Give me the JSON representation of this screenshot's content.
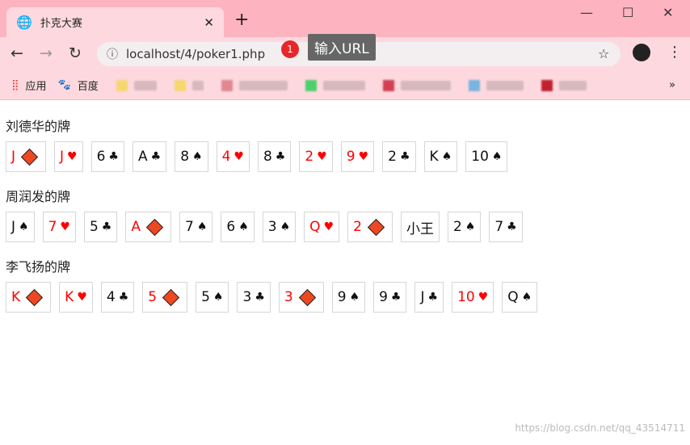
{
  "browser": {
    "tab_title": "扑克大赛",
    "url": "localhost/4/poker1.php",
    "badge": "1",
    "tooltip": "输入URL",
    "bookmarks": [
      {
        "label": "应用"
      },
      {
        "label": "百度"
      }
    ]
  },
  "players": [
    {
      "name": "刘德华的牌",
      "cards": [
        [
          "J",
          "diamond"
        ],
        [
          "J",
          "heart"
        ],
        [
          "6",
          "club"
        ],
        [
          "A",
          "club"
        ],
        [
          "8",
          "spade"
        ],
        [
          "4",
          "heart"
        ],
        [
          "8",
          "club"
        ],
        [
          "2",
          "heart"
        ],
        [
          "9",
          "heart"
        ],
        [
          "2",
          "club"
        ],
        [
          "K",
          "spade"
        ],
        [
          "10",
          "spade"
        ]
      ]
    },
    {
      "name": "周润发的牌",
      "cards": [
        [
          "J",
          "spade"
        ],
        [
          "7",
          "heart"
        ],
        [
          "5",
          "club"
        ],
        [
          "A",
          "diamond"
        ],
        [
          "7",
          "spade"
        ],
        [
          "6",
          "spade"
        ],
        [
          "3",
          "spade"
        ],
        [
          "Q",
          "heart"
        ],
        [
          "2",
          "diamond"
        ],
        [
          "小王",
          ""
        ],
        [
          "2",
          "spade"
        ],
        [
          "7",
          "club"
        ]
      ]
    },
    {
      "name": "李飞扬的牌",
      "cards": [
        [
          "K",
          "diamond"
        ],
        [
          "K",
          "heart"
        ],
        [
          "4",
          "club"
        ],
        [
          "5",
          "diamond"
        ],
        [
          "5",
          "spade"
        ],
        [
          "3",
          "club"
        ],
        [
          "3",
          "diamond"
        ],
        [
          "9",
          "spade"
        ],
        [
          "9",
          "club"
        ],
        [
          "J",
          "club"
        ],
        [
          "10",
          "heart"
        ],
        [
          "Q",
          "spade"
        ]
      ]
    }
  ],
  "watermark": "https://blog.csdn.net/qq_43514711",
  "colors": {
    "red": "#ff0000",
    "diamond": "#ee4822",
    "chrome": "#fdb4c0"
  }
}
